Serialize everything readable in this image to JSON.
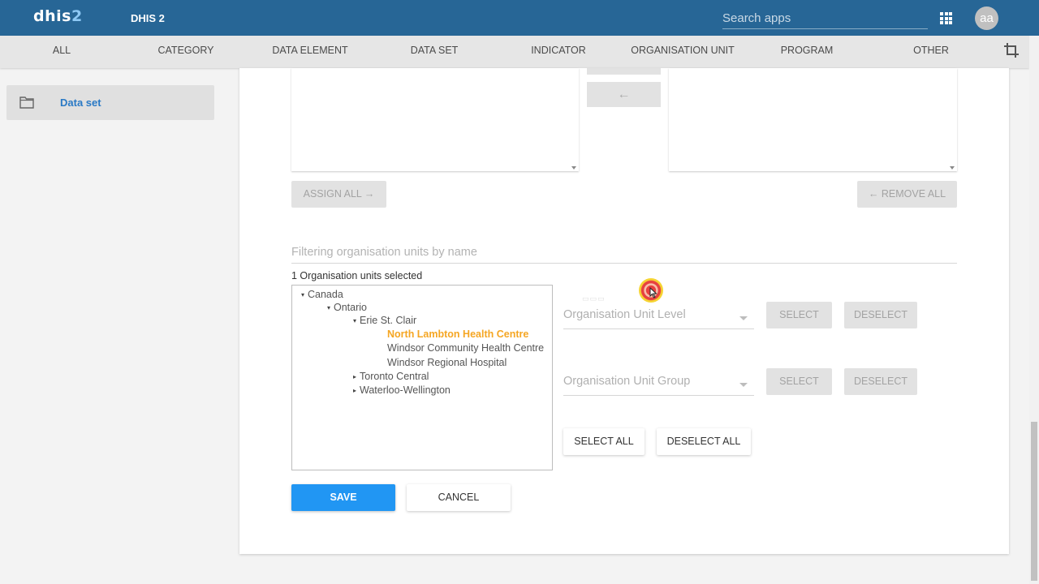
{
  "header": {
    "logo_main": "dhis",
    "logo_accent": "2",
    "app_title": "DHIS 2",
    "search_placeholder": "Search apps",
    "avatar_initials": "aa"
  },
  "tabs": [
    {
      "label": "ALL"
    },
    {
      "label": "CATEGORY"
    },
    {
      "label": "DATA ELEMENT"
    },
    {
      "label": "DATA SET"
    },
    {
      "label": "INDICATOR"
    },
    {
      "label": "ORGANISATION UNIT"
    },
    {
      "label": "PROGRAM"
    },
    {
      "label": "OTHER"
    }
  ],
  "sidebar": {
    "items": [
      {
        "label": "Data set",
        "icon": "folder-icon"
      }
    ]
  },
  "assign": {
    "remove_arrow": "←",
    "assign_all_label": "ASSIGN ALL →",
    "remove_all_label": "← REMOVE ALL"
  },
  "org_units": {
    "filter_placeholder": "Filtering organisation units by name",
    "selected_count_text": "1 Organisation units selected",
    "tree": [
      {
        "label": "Canada",
        "expanded": true
      },
      {
        "label": "Ontario",
        "expanded": true
      },
      {
        "label": "Erie St. Clair",
        "expanded": true
      },
      {
        "label": "North Lambton Health Centre",
        "selected": true
      },
      {
        "label": "Windsor Community Health Centre"
      },
      {
        "label": "Windsor Regional Hospital"
      },
      {
        "label": "Toronto Central",
        "expanded": false
      },
      {
        "label": "Waterloo-Wellington",
        "expanded": false
      }
    ],
    "level_placeholder": "Organisation Unit Level",
    "group_placeholder": "Organisation Unit Group",
    "select_label": "SELECT",
    "deselect_label": "DESELECT",
    "select_all_label": "SELECT ALL",
    "deselect_all_label": "DESELECT ALL"
  },
  "form": {
    "save_label": "SAVE",
    "cancel_label": "CANCEL"
  },
  "colors": {
    "header": "#276696",
    "primary": "#2196f3",
    "selected_node": "#f5a623",
    "sidebar_link": "#2979c5"
  }
}
